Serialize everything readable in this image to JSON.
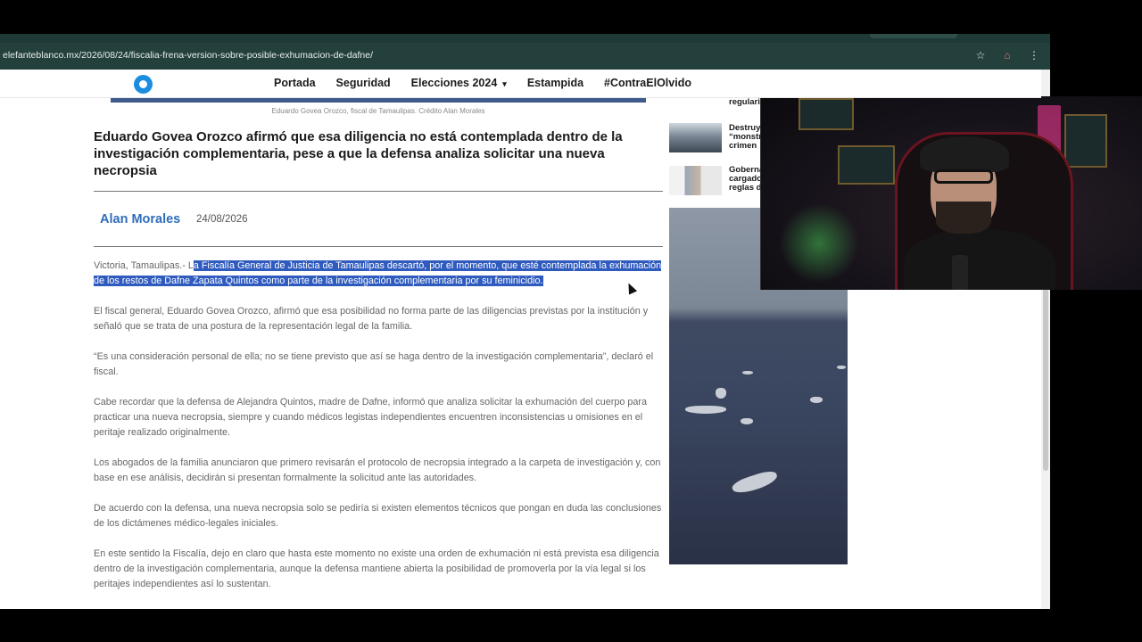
{
  "browser": {
    "url": "elefanteblanco.mx/2026/08/24/fiscalia-frena-version-sobre-posible-exhumacion-de-dafne/",
    "icons": [
      "star-icon",
      "home-icon",
      "menu-icon"
    ]
  },
  "site": {
    "nav": {
      "items": [
        "Portada",
        "Seguridad",
        "Elecciones 2024",
        "Estampida",
        "#ContraElOlvido"
      ],
      "caret": "▾"
    }
  },
  "article": {
    "caption": "Eduardo Govea Orozco, fiscal de Tamaulipas. Crédito Alan Morales",
    "headline": "Eduardo Govea Orozco afirmó que esa diligencia no está contemplada dentro de la investigación complementaria, pese a que la defensa analiza solicitar una nueva necropsia",
    "author": "Alan Morales",
    "date": "24/08/2026",
    "lead_prefix": "Victoria, Tamaulipas.- L",
    "lead_highlight": "a Fiscalía General de Justicia de Tamaulipas descartó, por el momento, que esté contemplada la exhumación de los restos de Dafne Zapata Quintos como parte de la investigación complementaria por su feminicidio.",
    "paragraphs": [
      "El fiscal general, Eduardo Govea Orozco, afirmó que esa posibilidad no forma parte de las diligencias previstas por la institución y señaló que se trata de una postura de la representación legal de la familia.",
      "“Es una consideración personal de ella; no se tiene previsto que así se haga dentro de la investigación complementaria”, declaró el fiscal.",
      "Cabe recordar que la defensa de Alejandra Quintos, madre de Dafne, informó que analiza solicitar la exhumación del cuerpo para practicar una nueva necropsia, siempre y cuando médicos legistas independientes encuentren inconsistencias u omisiones en el peritaje realizado originalmente.",
      "Los abogados de la familia anunciaron que primero revisarán el protocolo de necropsia integrado a la carpeta de investigación y, con base en ese análisis, decidirán si presentan formalmente la solicitud ante las autoridades.",
      "De acuerdo con la defensa, una nueva necropsia solo se pediría si existen elementos técnicos que pongan en duda las conclusiones de los dictámenes médico-legales iniciales.",
      "En este sentido la Fiscalía, dejo en claro que hasta este momento no existe una orden de exhumación ni está prevista esa diligencia dentro de la investigación complementaria, aunque la defensa mantiene abierta la posibilidad de promoverla por la vía legal si los peritajes independientes así lo sustentan."
    ]
  },
  "sidebar": {
    "items": [
      {
        "title_lines": [
          "regulari"
        ]
      },
      {
        "title_lines": [
          "Destruy",
          "“monstr",
          "crimen"
        ]
      },
      {
        "title_lines": [
          "Goberna",
          "cargado",
          "reglas d"
        ]
      }
    ]
  }
}
